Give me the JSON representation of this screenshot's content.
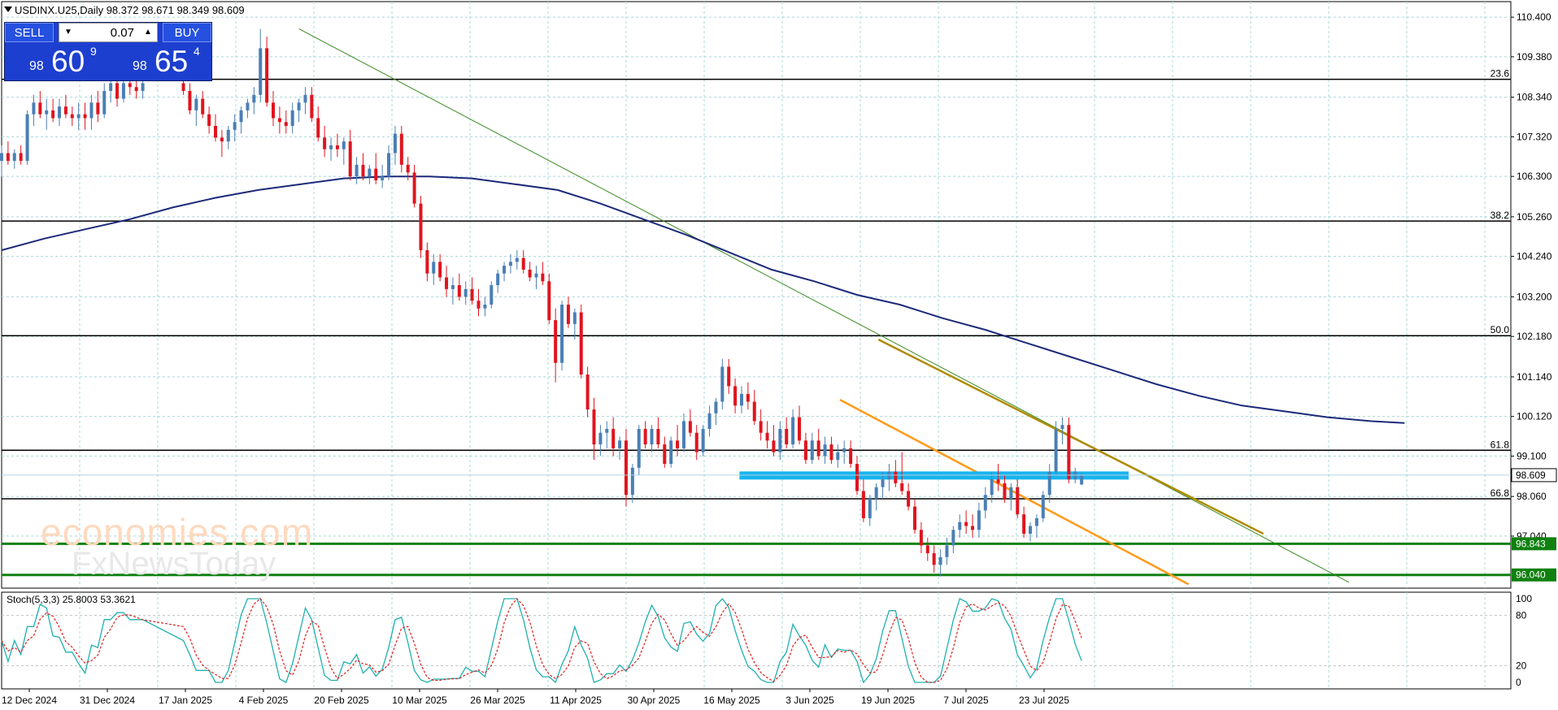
{
  "header": {
    "symbol_line": "USDINX.U25,Daily  98.372 98.671 98.349 98.609"
  },
  "trade_panel": {
    "sell_label": "SELL",
    "buy_label": "BUY",
    "lot_value": "0.07",
    "sell_price_prefix": "98",
    "sell_price_main": "60",
    "sell_price_sup": "9",
    "buy_price_prefix": "98",
    "buy_price_main": "65",
    "buy_price_sup": "4"
  },
  "watermark": {
    "line1": "economies.com",
    "line2": "FxNewsToday"
  },
  "chart_data": {
    "type": "candlestick",
    "price_axis": {
      "ticks": [
        "110.400",
        "109.380",
        "108.340",
        "107.320",
        "106.300",
        "105.260",
        "104.240",
        "103.200",
        "102.180",
        "101.140",
        "100.120",
        "99.100",
        "98.060",
        "97.040"
      ],
      "ylim": [
        95.7,
        110.8
      ]
    },
    "date_labels": [
      "12 Dec 2024",
      "31 Dec 2024",
      "17 Jan 2025",
      "4 Feb 2025",
      "20 Feb 2025",
      "10 Mar 2025",
      "26 Mar 2025",
      "11 Apr 2025",
      "30 Apr 2025",
      "16 May 2025",
      "3 Jun 2025",
      "19 Jun 2025",
      "7 Jul 2025",
      "23 Jul 2025"
    ],
    "fib_levels": [
      {
        "label": "23.6",
        "value": 108.8
      },
      {
        "label": "38.2",
        "value": 105.15
      },
      {
        "label": "50.0",
        "value": 102.2
      },
      {
        "label": "61.8",
        "value": 99.25
      },
      {
        "label": "66.8",
        "value": 98.0
      }
    ],
    "support_levels": [
      {
        "label": "96.843",
        "value": 96.843
      },
      {
        "label": "96.040",
        "value": 96.04
      }
    ],
    "current_price": "98.609",
    "support_zone": {
      "value": 98.6
    },
    "colors": {
      "bull": "#4a7fb5",
      "bear": "#e0141e",
      "ma": "#1c2a7a",
      "fib": "#000000",
      "support": "#108010",
      "zone": "#18b4ee",
      "trend_long": "#3a8a20",
      "trend_upper": "#b08a00",
      "trend_lower": "#ff9a1a",
      "stoch_main": "#20b0b0",
      "stoch_signal": "#e02020"
    },
    "moving_average": [
      [
        0,
        104.4
      ],
      [
        20,
        104.7
      ],
      [
        40,
        104.95
      ],
      [
        60,
        105.2
      ],
      [
        80,
        105.5
      ],
      [
        100,
        105.75
      ],
      [
        120,
        105.95
      ],
      [
        140,
        106.1
      ],
      [
        160,
        106.25
      ],
      [
        180,
        106.3
      ],
      [
        200,
        106.3
      ],
      [
        220,
        106.25
      ],
      [
        240,
        106.1
      ],
      [
        260,
        105.95
      ],
      [
        280,
        105.6
      ],
      [
        300,
        105.2
      ],
      [
        320,
        104.8
      ],
      [
        340,
        104.35
      ],
      [
        360,
        103.9
      ],
      [
        380,
        103.6
      ],
      [
        400,
        103.25
      ],
      [
        420,
        103.0
      ],
      [
        440,
        102.65
      ],
      [
        460,
        102.35
      ],
      [
        480,
        102.0
      ],
      [
        500,
        101.65
      ],
      [
        520,
        101.3
      ],
      [
        540,
        100.95
      ],
      [
        560,
        100.65
      ],
      [
        580,
        100.4
      ],
      [
        600,
        100.25
      ],
      [
        620,
        100.1
      ],
      [
        640,
        100.0
      ],
      [
        656,
        99.95
      ]
    ],
    "trend_lines": [
      {
        "name": "long",
        "from": [
          139,
          110.1
        ],
        "to": [
          630,
          95.85
        ]
      },
      {
        "name": "upper",
        "from": [
          410,
          102.1
        ],
        "to": [
          590,
          97.1
        ]
      },
      {
        "name": "lower",
        "from": [
          392,
          100.55
        ],
        "to": [
          555,
          95.8
        ]
      }
    ],
    "stochastic": {
      "label": "Stoch(5,3,3) 25.8003 53.3621",
      "ticks": [
        "100",
        "80",
        "20",
        "0"
      ],
      "main": 25.8003,
      "signal": 53.3621
    },
    "candles": [
      [
        0,
        106.7,
        107.1,
        106.3,
        106.9
      ],
      [
        3,
        106.9,
        107.2,
        106.6,
        106.7
      ],
      [
        6,
        106.7,
        107.0,
        106.5,
        106.9
      ],
      [
        9,
        106.9,
        107.1,
        106.6,
        106.7
      ],
      [
        12,
        106.7,
        108.0,
        106.6,
        107.9
      ],
      [
        15,
        107.9,
        108.4,
        107.6,
        108.2
      ],
      [
        18,
        108.2,
        108.5,
        107.8,
        107.9
      ],
      [
        21,
        107.9,
        108.3,
        107.5,
        108.0
      ],
      [
        24,
        108.0,
        108.3,
        107.7,
        107.8
      ],
      [
        27,
        107.8,
        108.3,
        107.6,
        108.1
      ],
      [
        30,
        108.1,
        108.4,
        107.8,
        107.9
      ],
      [
        33,
        107.9,
        108.1,
        107.6,
        107.8
      ],
      [
        36,
        107.8,
        108.2,
        107.5,
        107.9
      ],
      [
        39,
        107.9,
        108.2,
        107.5,
        107.8
      ],
      [
        42,
        107.8,
        108.4,
        107.5,
        108.2
      ],
      [
        45,
        108.2,
        108.5,
        107.7,
        107.9
      ],
      [
        48,
        107.9,
        108.7,
        107.8,
        108.5
      ],
      [
        51,
        108.5,
        108.9,
        108.2,
        108.7
      ],
      [
        54,
        108.7,
        108.9,
        108.1,
        108.3
      ],
      [
        57,
        108.3,
        108.9,
        108.2,
        108.7
      ],
      [
        60,
        108.7,
        109.1,
        108.4,
        108.6
      ],
      [
        63,
        108.6,
        108.9,
        108.3,
        108.5
      ],
      [
        66,
        108.5,
        108.9,
        108.3,
        108.7
      ],
      [
        85,
        108.7,
        108.9,
        108.4,
        108.5
      ],
      [
        88,
        108.5,
        108.7,
        107.9,
        108.0
      ],
      [
        91,
        108.0,
        108.4,
        107.6,
        108.3
      ],
      [
        94,
        108.3,
        108.5,
        107.8,
        107.9
      ],
      [
        97,
        107.9,
        108.1,
        107.4,
        107.6
      ],
      [
        100,
        107.6,
        107.9,
        107.2,
        107.3
      ],
      [
        103,
        107.3,
        107.5,
        106.8,
        107.2
      ],
      [
        106,
        107.2,
        107.6,
        107.0,
        107.5
      ],
      [
        109,
        107.5,
        107.9,
        107.2,
        107.7
      ],
      [
        112,
        107.7,
        108.1,
        107.4,
        108.0
      ],
      [
        115,
        108.0,
        108.3,
        107.8,
        108.2
      ],
      [
        118,
        108.2,
        108.6,
        107.9,
        108.4
      ],
      [
        121,
        108.4,
        110.1,
        108.2,
        109.6
      ],
      [
        124,
        109.6,
        109.9,
        108.1,
        108.2
      ],
      [
        127,
        108.2,
        108.5,
        107.6,
        107.8
      ],
      [
        130,
        107.8,
        108.1,
        107.4,
        107.7
      ],
      [
        133,
        107.7,
        108.0,
        107.4,
        107.6
      ],
      [
        136,
        107.6,
        108.2,
        107.4,
        108.0
      ],
      [
        139,
        108.0,
        108.3,
        107.7,
        108.2
      ],
      [
        142,
        108.2,
        108.6,
        107.9,
        108.4
      ],
      [
        145,
        108.4,
        108.6,
        107.7,
        107.8
      ],
      [
        148,
        107.8,
        108.1,
        107.2,
        107.3
      ],
      [
        151,
        107.3,
        107.6,
        106.8,
        107.0
      ],
      [
        154,
        107.0,
        107.3,
        106.7,
        107.1
      ],
      [
        157,
        107.1,
        107.4,
        106.8,
        107.0
      ],
      [
        160,
        107.0,
        107.3,
        106.6,
        107.2
      ],
      [
        163,
        107.2,
        107.5,
        106.2,
        106.3
      ],
      [
        166,
        106.3,
        106.8,
        106.1,
        106.6
      ],
      [
        169,
        106.6,
        106.9,
        106.2,
        106.3
      ],
      [
        172,
        106.3,
        106.6,
        106.1,
        106.5
      ],
      [
        175,
        106.5,
        106.9,
        106.1,
        106.2
      ],
      [
        178,
        106.2,
        106.6,
        106.0,
        106.3
      ],
      [
        181,
        106.3,
        107.1,
        106.2,
        106.9
      ],
      [
        184,
        106.9,
        107.6,
        106.6,
        107.4
      ],
      [
        187,
        107.4,
        107.6,
        106.4,
        106.6
      ],
      [
        190,
        106.6,
        106.8,
        106.2,
        106.4
      ],
      [
        193,
        106.4,
        106.6,
        105.5,
        105.6
      ],
      [
        196,
        105.6,
        105.8,
        104.2,
        104.4
      ],
      [
        199,
        104.4,
        104.6,
        103.6,
        103.8
      ],
      [
        202,
        103.8,
        104.3,
        103.5,
        104.1
      ],
      [
        205,
        104.1,
        104.3,
        103.6,
        103.7
      ],
      [
        208,
        103.7,
        104.0,
        103.2,
        103.4
      ],
      [
        211,
        103.4,
        103.7,
        103.0,
        103.5
      ],
      [
        214,
        103.5,
        103.8,
        103.1,
        103.2
      ],
      [
        217,
        103.2,
        103.6,
        103.0,
        103.4
      ],
      [
        220,
        103.4,
        103.7,
        103.0,
        103.1
      ],
      [
        223,
        103.1,
        103.4,
        102.7,
        102.9
      ],
      [
        226,
        102.9,
        103.2,
        102.7,
        103.0
      ],
      [
        229,
        103.0,
        103.6,
        102.9,
        103.5
      ],
      [
        232,
        103.5,
        103.9,
        103.3,
        103.8
      ],
      [
        235,
        103.8,
        104.1,
        103.6,
        104.0
      ],
      [
        238,
        104.0,
        104.3,
        103.8,
        104.1
      ],
      [
        241,
        104.1,
        104.4,
        103.9,
        104.2
      ],
      [
        244,
        104.2,
        104.4,
        103.8,
        103.9
      ],
      [
        247,
        103.9,
        104.1,
        103.6,
        103.7
      ],
      [
        250,
        103.7,
        104.0,
        103.4,
        103.8
      ],
      [
        253,
        103.8,
        104.1,
        103.5,
        103.6
      ],
      [
        256,
        103.6,
        103.8,
        102.5,
        102.6
      ],
      [
        259,
        102.6,
        102.9,
        101.0,
        101.5
      ],
      [
        262,
        101.5,
        103.1,
        101.3,
        103.0
      ],
      [
        265,
        103.0,
        103.2,
        102.4,
        102.5
      ],
      [
        268,
        102.5,
        102.9,
        102.1,
        102.8
      ],
      [
        271,
        102.8,
        103.0,
        101.1,
        101.2
      ],
      [
        274,
        101.2,
        101.4,
        100.1,
        100.3
      ],
      [
        277,
        100.3,
        100.6,
        99.0,
        99.4
      ],
      [
        280,
        99.4,
        99.9,
        99.1,
        99.7
      ],
      [
        283,
        99.7,
        100.0,
        99.3,
        99.8
      ],
      [
        286,
        99.8,
        100.1,
        99.1,
        99.3
      ],
      [
        289,
        99.3,
        99.6,
        99.0,
        99.5
      ],
      [
        292,
        99.5,
        99.8,
        97.8,
        98.1
      ],
      [
        295,
        98.1,
        98.9,
        97.9,
        98.8
      ],
      [
        298,
        98.8,
        99.9,
        98.6,
        99.8
      ],
      [
        301,
        99.8,
        100.0,
        99.3,
        99.4
      ],
      [
        304,
        99.4,
        99.9,
        99.2,
        99.8
      ],
      [
        307,
        99.8,
        100.1,
        99.3,
        99.4
      ],
      [
        310,
        99.4,
        99.6,
        98.8,
        98.9
      ],
      [
        313,
        98.9,
        99.6,
        98.8,
        99.5
      ],
      [
        316,
        99.5,
        99.9,
        99.1,
        99.3
      ],
      [
        319,
        99.3,
        100.2,
        99.2,
        100.0
      ],
      [
        322,
        100.0,
        100.3,
        99.6,
        99.7
      ],
      [
        325,
        99.7,
        99.9,
        99.0,
        99.2
      ],
      [
        328,
        99.2,
        99.9,
        99.1,
        99.8
      ],
      [
        331,
        99.8,
        100.4,
        99.6,
        100.2
      ],
      [
        334,
        100.2,
        100.6,
        99.9,
        100.5
      ],
      [
        337,
        100.5,
        101.6,
        100.3,
        101.4
      ],
      [
        340,
        101.4,
        101.6,
        100.7,
        100.9
      ],
      [
        343,
        100.9,
        101.1,
        100.2,
        100.4
      ],
      [
        346,
        100.4,
        100.9,
        100.2,
        100.7
      ],
      [
        349,
        100.7,
        101.0,
        100.3,
        100.5
      ],
      [
        352,
        100.5,
        100.8,
        99.9,
        100.0
      ],
      [
        355,
        100.0,
        100.3,
        99.5,
        99.7
      ],
      [
        358,
        99.7,
        100.0,
        99.3,
        99.5
      ],
      [
        361,
        99.5,
        99.9,
        99.1,
        99.2
      ],
      [
        364,
        99.2,
        100.0,
        99.0,
        99.8
      ],
      [
        367,
        99.8,
        100.1,
        99.3,
        99.4
      ],
      [
        370,
        99.4,
        100.3,
        99.3,
        100.1
      ],
      [
        373,
        100.1,
        100.4,
        99.4,
        99.5
      ],
      [
        376,
        99.5,
        99.7,
        98.9,
        99.0
      ],
      [
        379,
        99.0,
        99.7,
        98.9,
        99.5
      ],
      [
        382,
        99.5,
        99.8,
        99.0,
        99.1
      ],
      [
        385,
        99.1,
        99.6,
        98.9,
        99.4
      ],
      [
        388,
        99.4,
        99.6,
        98.9,
        99.0
      ],
      [
        391,
        99.0,
        99.4,
        98.8,
        99.2
      ],
      [
        394,
        99.2,
        99.5,
        98.9,
        99.3
      ],
      [
        397,
        99.3,
        99.5,
        98.8,
        98.9
      ],
      [
        400,
        98.9,
        99.1,
        98.1,
        98.2
      ],
      [
        403,
        98.2,
        98.5,
        97.4,
        97.5
      ],
      [
        406,
        97.5,
        98.1,
        97.3,
        98.0
      ],
      [
        409,
        98.0,
        98.4,
        97.7,
        98.3
      ],
      [
        412,
        98.3,
        98.7,
        98.0,
        98.5
      ],
      [
        415,
        98.5,
        98.9,
        98.2,
        98.7
      ],
      [
        418,
        98.7,
        99.0,
        98.3,
        98.4
      ],
      [
        421,
        98.4,
        99.2,
        98.1,
        98.2
      ],
      [
        424,
        98.2,
        98.4,
        97.7,
        97.8
      ],
      [
        427,
        97.8,
        98.0,
        97.1,
        97.2
      ],
      [
        430,
        97.2,
        97.4,
        96.6,
        96.8
      ],
      [
        433,
        96.8,
        97.0,
        96.4,
        96.6
      ],
      [
        436,
        96.6,
        96.8,
        96.1,
        96.3
      ],
      [
        439,
        96.3,
        96.7,
        96.0,
        96.5
      ],
      [
        442,
        96.5,
        97.0,
        96.3,
        96.8
      ],
      [
        445,
        96.8,
        97.3,
        96.6,
        97.2
      ],
      [
        448,
        97.2,
        97.6,
        97.0,
        97.4
      ],
      [
        451,
        97.4,
        97.7,
        97.1,
        97.3
      ],
      [
        454,
        97.3,
        97.6,
        97.0,
        97.2
      ],
      [
        457,
        97.2,
        97.9,
        97.0,
        97.7
      ],
      [
        460,
        97.7,
        98.3,
        97.5,
        98.1
      ],
      [
        463,
        98.1,
        98.7,
        97.9,
        98.5
      ],
      [
        466,
        98.5,
        98.9,
        98.2,
        98.4
      ],
      [
        469,
        98.4,
        98.6,
        97.9,
        98.0
      ],
      [
        472,
        98.0,
        98.4,
        97.7,
        98.3
      ],
      [
        475,
        98.3,
        98.5,
        97.5,
        97.6
      ],
      [
        478,
        97.6,
        97.8,
        97.0,
        97.1
      ],
      [
        481,
        97.1,
        97.4,
        96.9,
        97.3
      ],
      [
        484,
        97.3,
        97.6,
        97.0,
        97.5
      ],
      [
        487,
        97.5,
        98.2,
        97.4,
        98.1
      ],
      [
        490,
        98.1,
        98.9,
        97.9,
        98.7
      ],
      [
        493,
        98.7,
        100.0,
        98.6,
        99.8
      ],
      [
        496,
        99.8,
        100.1,
        99.4,
        99.9
      ],
      [
        499,
        99.9,
        100.1,
        98.4,
        98.5
      ],
      [
        502,
        98.5,
        98.8,
        98.4,
        98.7
      ],
      [
        505,
        98.37,
        98.67,
        98.35,
        98.61
      ]
    ]
  }
}
